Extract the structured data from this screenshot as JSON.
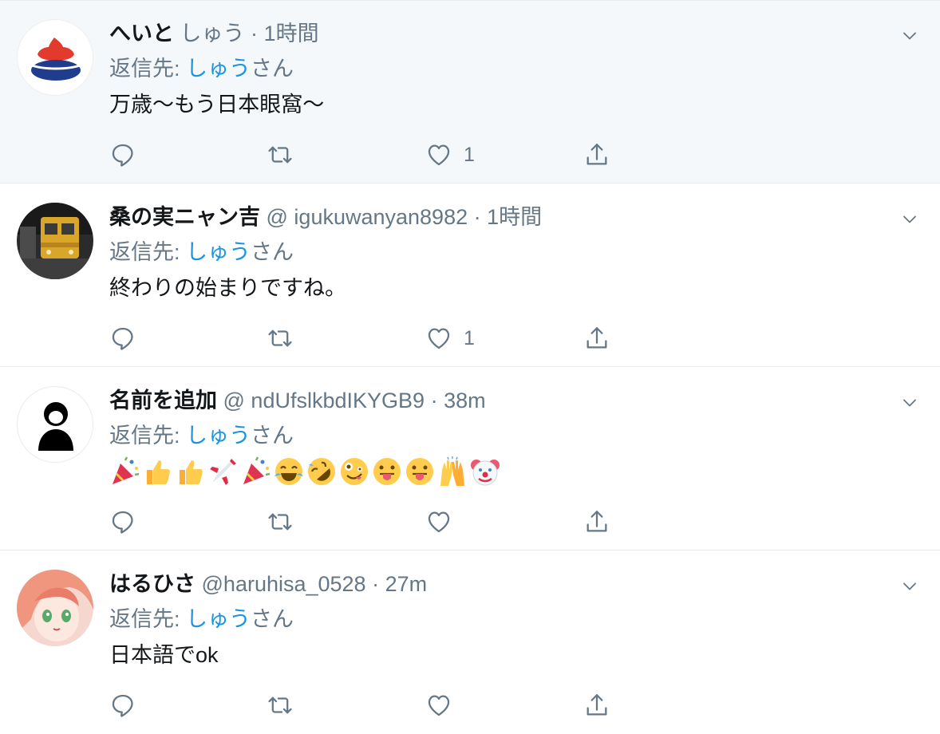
{
  "tweets": [
    {
      "name": "へいと",
      "handle": "しゅう",
      "sep": "·",
      "time": "1時間",
      "reply_prefix": "返信先: ",
      "reply_to": "しゅう",
      "reply_suffix": "さん",
      "text": "万歳〜もう日本眼窩〜",
      "likes": "1",
      "avatar": "red-blue-shape-logo"
    },
    {
      "name": "桑の実ニャン吉",
      "handle": "@ igukuwanyan8982",
      "sep": "·",
      "time": "1時間",
      "reply_prefix": "返信先: ",
      "reply_to": "しゅう",
      "reply_suffix": "さん",
      "text": "終わりの始まりですね。",
      "likes": "1",
      "avatar": "yellow-train-photo"
    },
    {
      "name": "名前を追加",
      "handle": "@ ndUfslkbdIKYGB9",
      "sep": "·",
      "time": "38m",
      "reply_prefix": "返信先: ",
      "reply_to": "しゅう",
      "reply_suffix": "さん",
      "emojis": [
        "party-popper",
        "thumbs-up",
        "thumbs-up",
        "airplane",
        "party-popper",
        "tears-of-joy",
        "rolling-laughing",
        "zany-face",
        "tongue-face",
        "tongue-face",
        "raising-hands",
        "clown-face"
      ],
      "likes": "",
      "avatar": "person-silhouette"
    },
    {
      "name": "はるひさ",
      "handle": "@haruhisa_0528",
      "sep": "·",
      "time": "27m",
      "reply_prefix": "返信先: ",
      "reply_to": "しゅう",
      "reply_suffix": "さん",
      "text": "日本語でok",
      "likes": "",
      "avatar": "anime-girl-illustration"
    }
  ],
  "colors": {
    "link": "#1b95e0",
    "secondary": "#657786",
    "highlight_bg": "#f5f8fa",
    "divider": "#e6ecf0"
  }
}
